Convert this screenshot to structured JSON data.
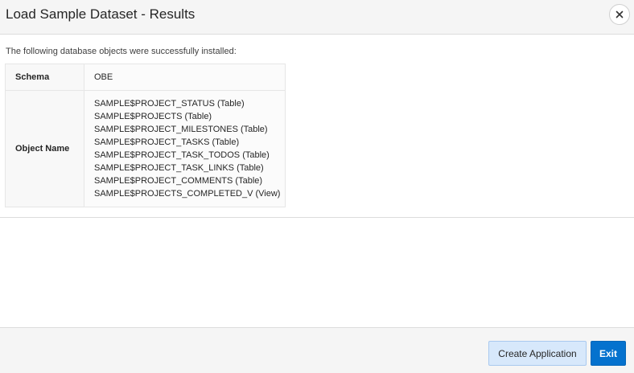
{
  "dialog": {
    "title": "Load Sample Dataset - Results",
    "close_icon": "close-icon"
  },
  "content": {
    "intro": "The following database objects were successfully installed:",
    "schema_label": "Schema",
    "schema_value": "OBE",
    "objects_label": "Object Name",
    "objects": [
      "SAMPLE$PROJECT_STATUS (Table)",
      "SAMPLE$PROJECTS (Table)",
      "SAMPLE$PROJECT_MILESTONES (Table)",
      "SAMPLE$PROJECT_TASKS (Table)",
      "SAMPLE$PROJECT_TASK_TODOS (Table)",
      "SAMPLE$PROJECT_TASK_LINKS (Table)",
      "SAMPLE$PROJECT_COMMENTS (Table)",
      "SAMPLE$PROJECTS_COMPLETED_V (View)"
    ]
  },
  "footer": {
    "create_application_label": "Create Application",
    "exit_label": "Exit"
  },
  "colors": {
    "primary_button": "#0572ce",
    "secondary_button": "#d7e8fb"
  }
}
